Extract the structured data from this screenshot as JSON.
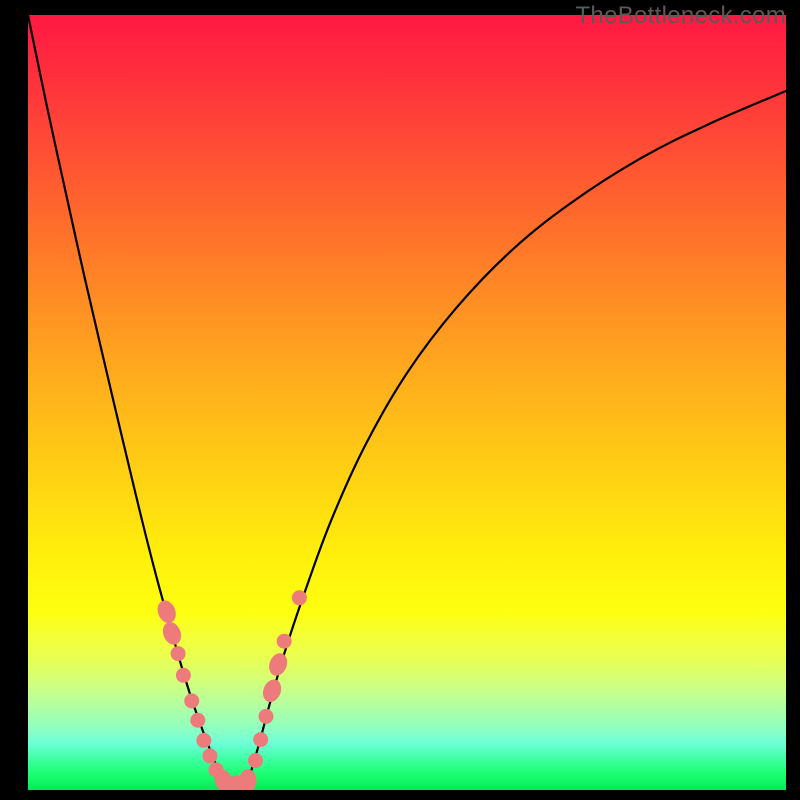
{
  "watermark": "TheBottleneck.com",
  "colors": {
    "curve_stroke": "#000000",
    "marker_fill": "#ee7b7c",
    "marker_stroke": "#ee7b7c",
    "frame_bg": "#000000"
  },
  "chart_data": {
    "type": "line",
    "title": "",
    "xlabel": "",
    "ylabel": "",
    "xlim": [
      0,
      1
    ],
    "ylim": [
      0,
      1
    ],
    "grid": false,
    "axes_visible": false,
    "note": "No numeric axis ticks are visible; x/y values are normalized (0–1) fractions of the visible plot area, y=0 at bottom and y=1 at top.",
    "series": [
      {
        "name": "left-branch",
        "x": [
          0.0,
          0.025,
          0.05,
          0.075,
          0.1,
          0.12,
          0.14,
          0.155,
          0.17,
          0.185,
          0.2,
          0.215,
          0.23,
          0.245,
          0.258
        ],
        "y": [
          1.0,
          0.882,
          0.77,
          0.66,
          0.555,
          0.472,
          0.39,
          0.33,
          0.273,
          0.22,
          0.168,
          0.12,
          0.078,
          0.04,
          0.01
        ]
      },
      {
        "name": "right-branch",
        "x": [
          0.29,
          0.305,
          0.32,
          0.34,
          0.365,
          0.4,
          0.445,
          0.5,
          0.565,
          0.64,
          0.72,
          0.81,
          0.9,
          1.0
        ],
        "y": [
          0.01,
          0.06,
          0.115,
          0.182,
          0.255,
          0.348,
          0.445,
          0.538,
          0.622,
          0.698,
          0.76,
          0.816,
          0.86,
          0.902
        ]
      },
      {
        "name": "valley-floor",
        "x": [
          0.258,
          0.275,
          0.29
        ],
        "y": [
          0.01,
          0.002,
          0.01
        ]
      }
    ],
    "markers": [
      {
        "x": 0.183,
        "y": 0.23,
        "rLong": true
      },
      {
        "x": 0.19,
        "y": 0.202,
        "rLong": true
      },
      {
        "x": 0.198,
        "y": 0.176,
        "rLong": false
      },
      {
        "x": 0.205,
        "y": 0.148
      },
      {
        "x": 0.216,
        "y": 0.115
      },
      {
        "x": 0.224,
        "y": 0.09
      },
      {
        "x": 0.232,
        "y": 0.064
      },
      {
        "x": 0.24,
        "y": 0.044
      },
      {
        "x": 0.248,
        "y": 0.026
      },
      {
        "x": 0.258,
        "y": 0.012,
        "rLong": true
      },
      {
        "x": 0.275,
        "y": 0.004,
        "rLong": true
      },
      {
        "x": 0.29,
        "y": 0.012,
        "rLong": true
      },
      {
        "x": 0.3,
        "y": 0.038
      },
      {
        "x": 0.307,
        "y": 0.065
      },
      {
        "x": 0.314,
        "y": 0.095
      },
      {
        "x": 0.322,
        "y": 0.128,
        "rLong": true
      },
      {
        "x": 0.33,
        "y": 0.162,
        "rLong": true
      },
      {
        "x": 0.338,
        "y": 0.192
      },
      {
        "x": 0.358,
        "y": 0.248
      }
    ]
  }
}
